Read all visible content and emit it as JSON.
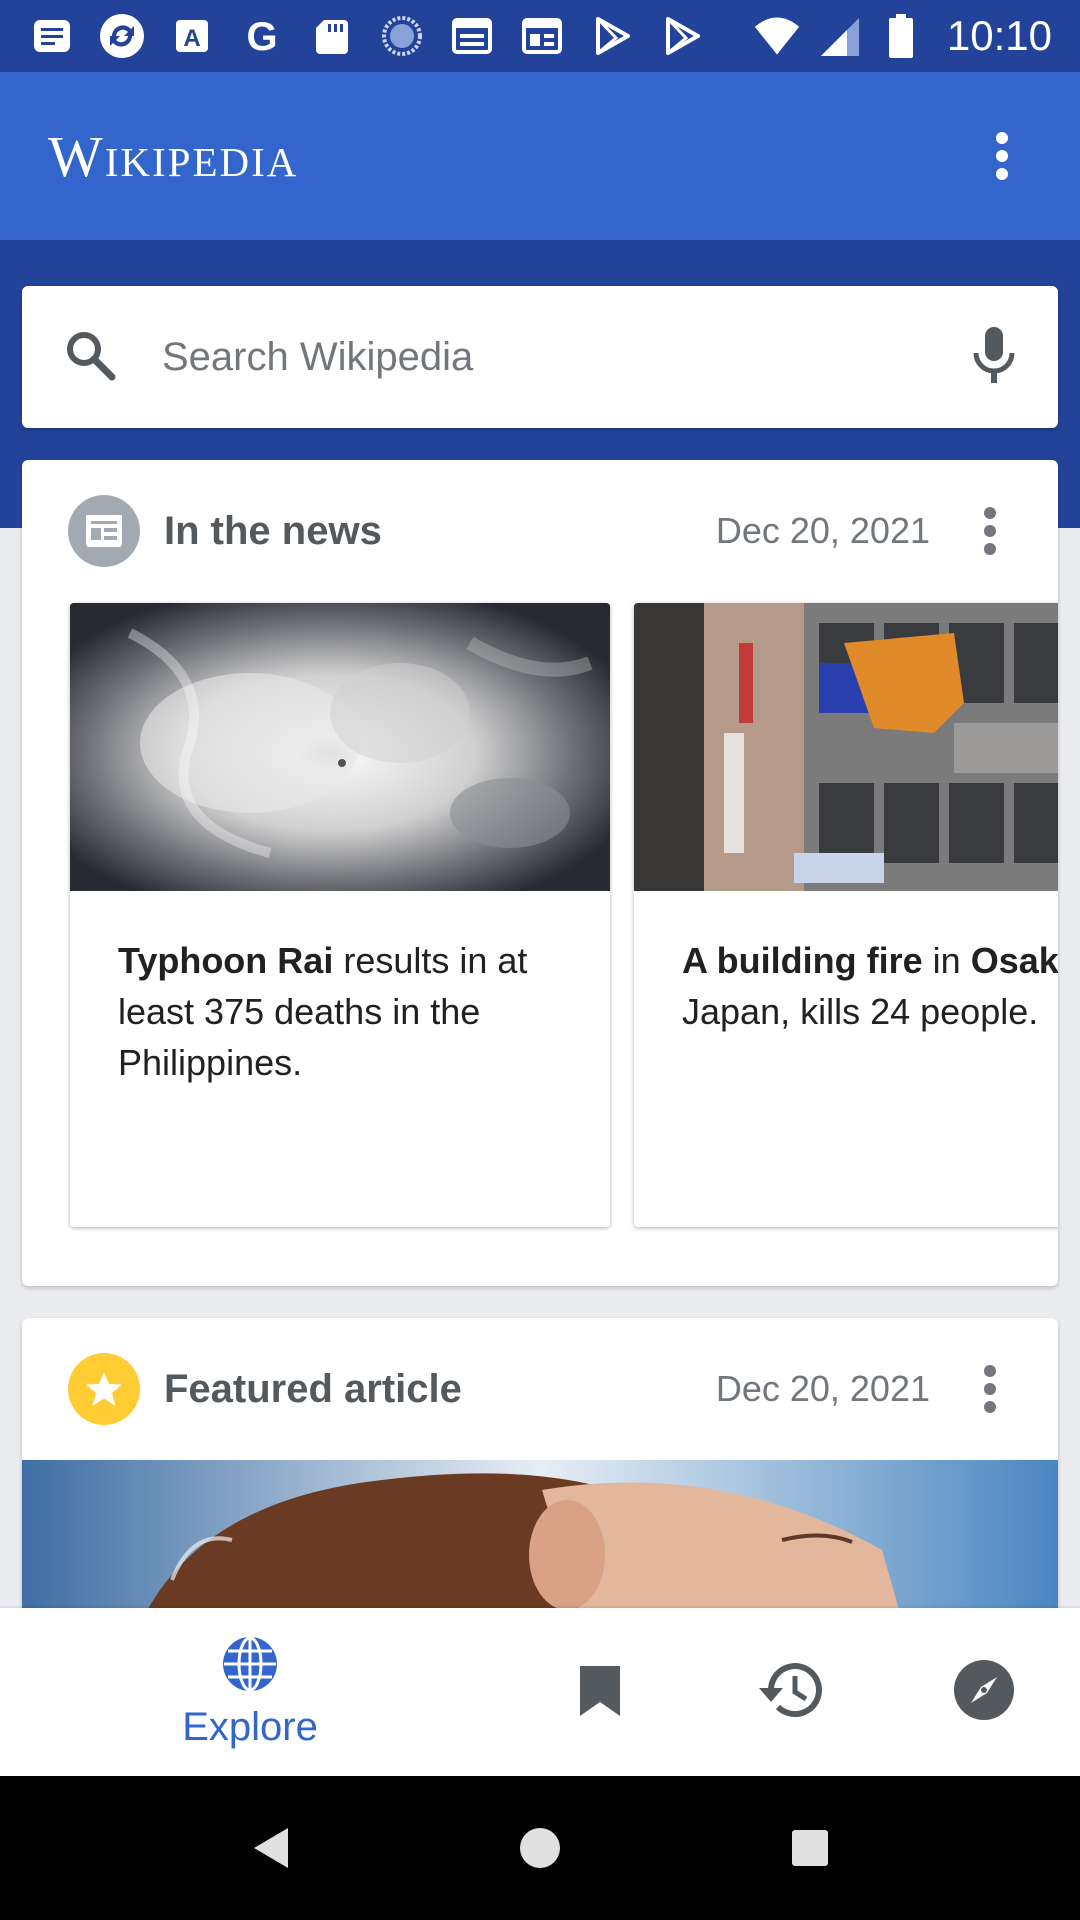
{
  "status_bar": {
    "time": "10:10",
    "left_icons": [
      "notes-icon",
      "sync-icon",
      "font-icon",
      "google-icon",
      "sd-card-icon",
      "loading-icon",
      "calendar-icon",
      "news-icon",
      "play-store-icon",
      "play-store-icon"
    ],
    "right_icons": [
      "wifi-icon",
      "signal-icon",
      "battery-icon"
    ]
  },
  "app_bar": {
    "title": "Wikipedia",
    "menu_icon": "more-vert-icon"
  },
  "search": {
    "placeholder": "Search Wikipedia",
    "left_icon": "search-icon",
    "right_icon": "mic-icon"
  },
  "cards": {
    "news": {
      "title": "In the news",
      "date": "Dec 20, 2021",
      "icon": "news-icon",
      "icon_bg": "#a2a9b1",
      "items": [
        {
          "bold1": "Typhoon Rai",
          "text1": " results in at",
          "line2": "least 375 deaths in the",
          "line3": "Philippines.",
          "image": "satellite-typhoon-image"
        },
        {
          "bold1": "A building fire",
          "text1": " in ",
          "bold2": "Osaka",
          "text2": ",",
          "line2": "Japan, kills 24 people.",
          "image": "building-fire-image"
        }
      ]
    },
    "featured": {
      "title": "Featured article",
      "date": "Dec 20, 2021",
      "icon": "star-icon",
      "icon_bg": "#fc3"
    }
  },
  "bottom_nav": {
    "items": [
      {
        "label": "Explore",
        "icon": "globe-icon",
        "active": true
      },
      {
        "label": "",
        "icon": "bookmark-icon",
        "active": false
      },
      {
        "label": "",
        "icon": "history-icon",
        "active": false
      },
      {
        "label": "",
        "icon": "compass-icon",
        "active": false
      }
    ],
    "active_color": "#3366cc",
    "inactive_color": "#54595d"
  },
  "system_nav": {
    "buttons": [
      "back-icon",
      "home-icon",
      "recents-icon"
    ]
  },
  "colors": {
    "status_bar": "#23439b",
    "app_bar": "#3366cc",
    "background": "#eaecf0"
  }
}
